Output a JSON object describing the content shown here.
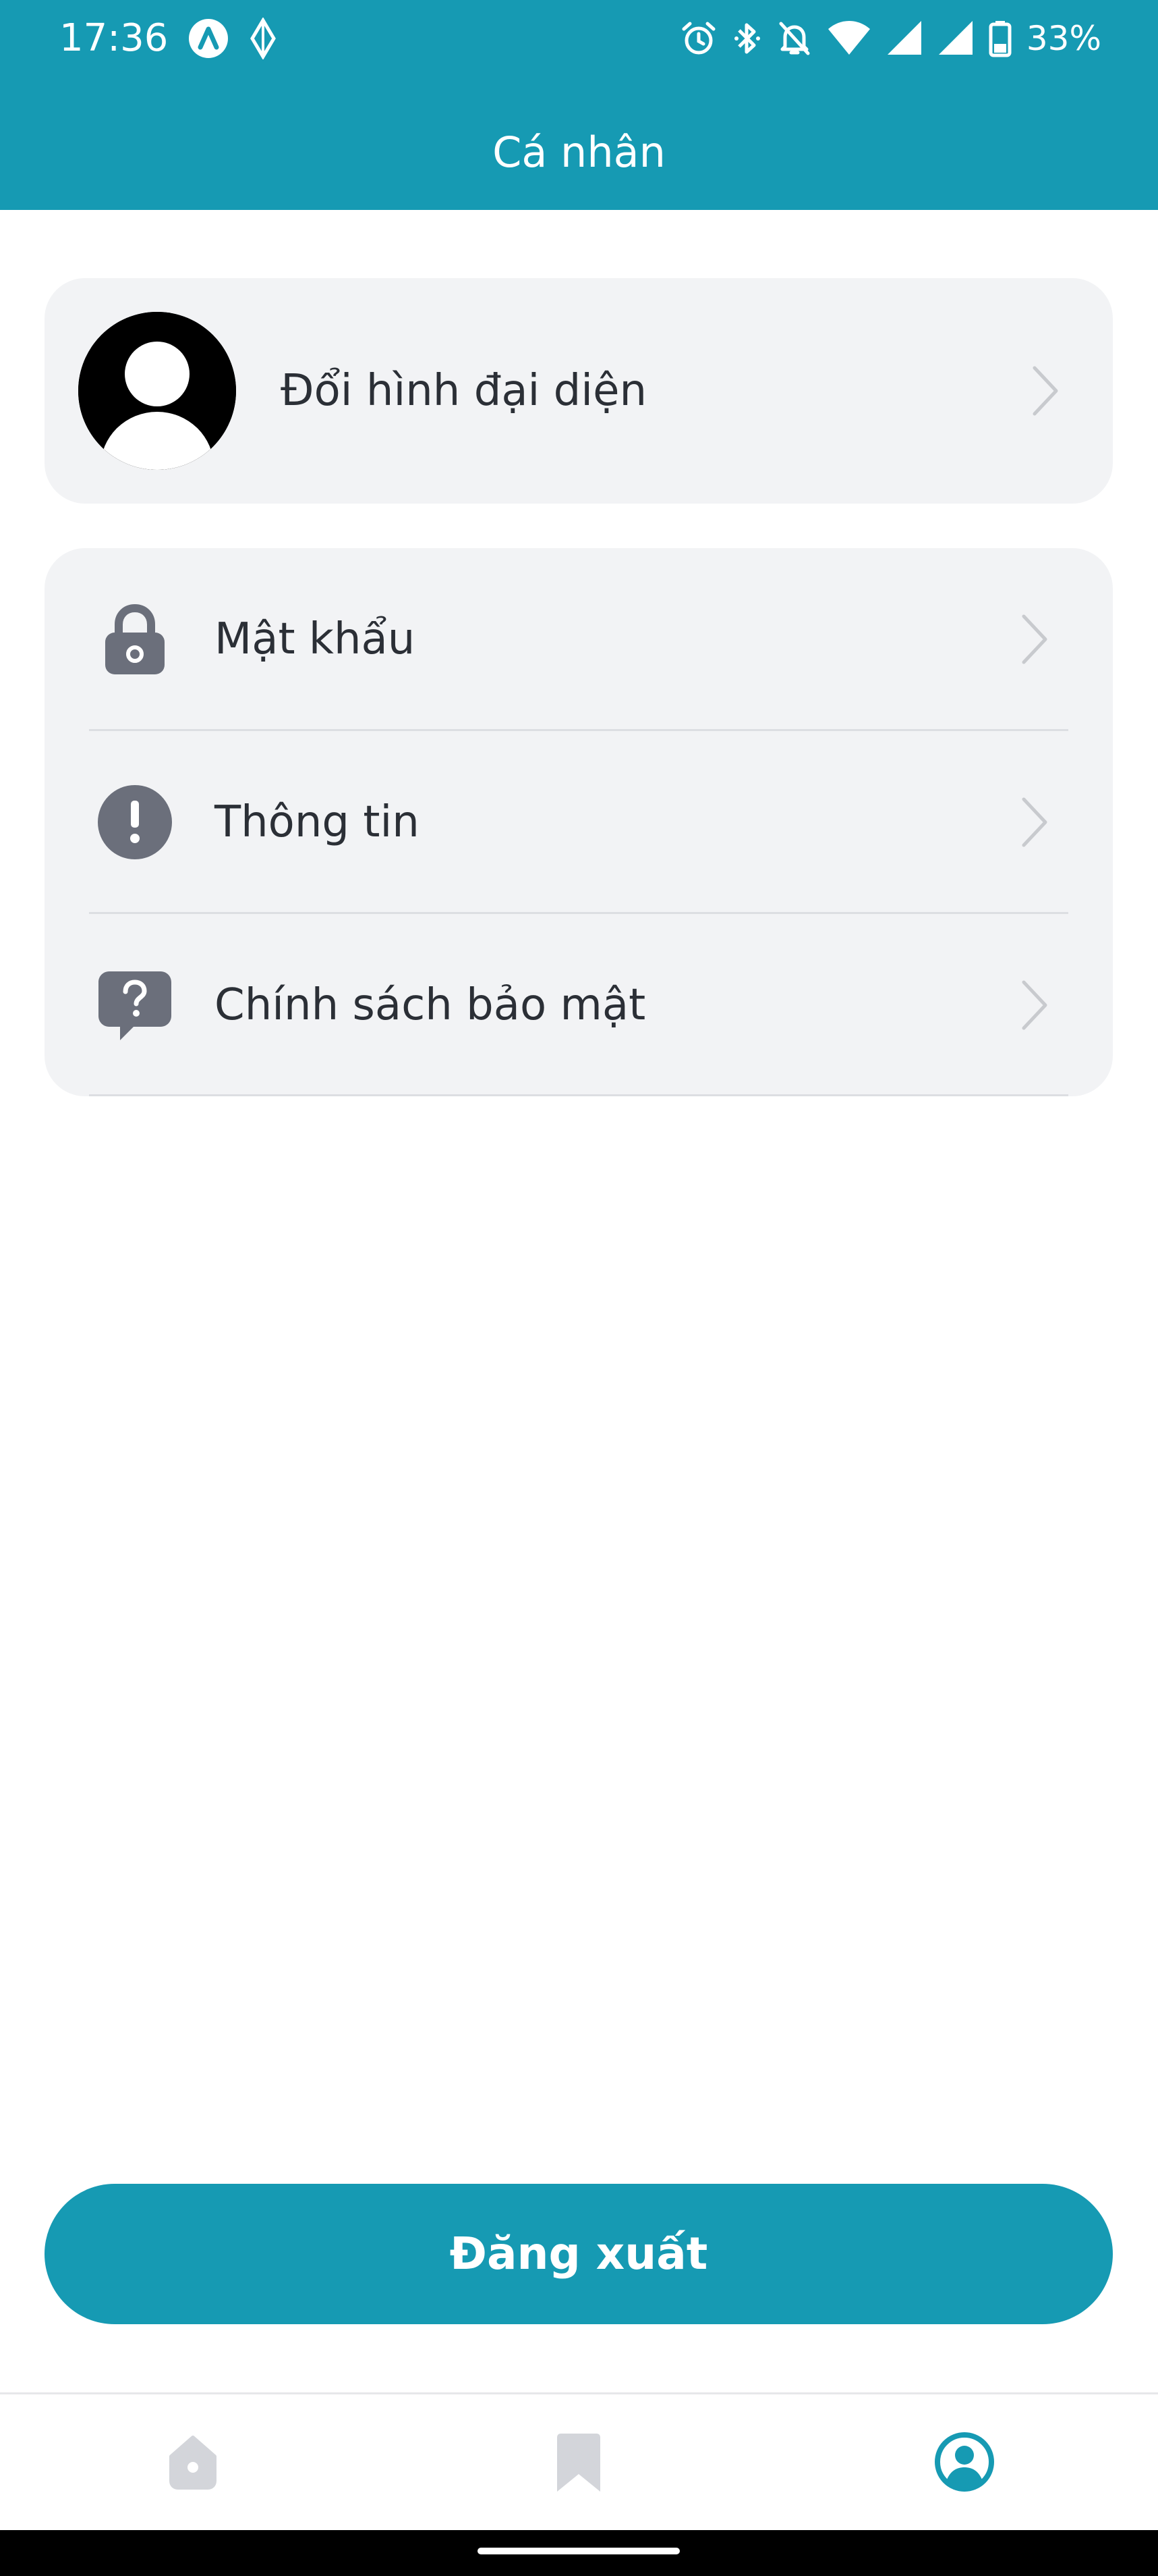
{
  "status_bar": {
    "time": "17:36",
    "left_icons": [
      "app-a-icon",
      "app-diamond-icon"
    ],
    "right_icons": [
      "alarm-icon",
      "bluetooth-icon",
      "notifications-off-icon",
      "wifi-icon",
      "signal-icon",
      "signal-icon",
      "battery-icon"
    ],
    "battery": "33%"
  },
  "header": {
    "title": "Cá nhân"
  },
  "profile": {
    "avatar_icon": "default-avatar-icon",
    "change_avatar_label": "Đổi hình đại diện"
  },
  "menu": {
    "items": [
      {
        "label": "Mật khẩu",
        "icon": "lock-icon"
      },
      {
        "label": "Thông tin",
        "icon": "info-icon"
      },
      {
        "label": "Chính sách bảo mật",
        "icon": "help-chat-icon"
      }
    ]
  },
  "actions": {
    "logout_label": "Đăng xuất"
  },
  "bottom_nav": {
    "items": [
      {
        "icon": "home-icon",
        "active": false
      },
      {
        "icon": "bookmark-icon",
        "active": false
      },
      {
        "icon": "profile-icon",
        "active": true
      }
    ]
  },
  "colors": {
    "primary": "#169ab3",
    "card_background": "#f2f3f5",
    "icon_gray": "#6b6f7b",
    "inactive_nav": "#d3d5da",
    "text": "#2b2f36"
  }
}
